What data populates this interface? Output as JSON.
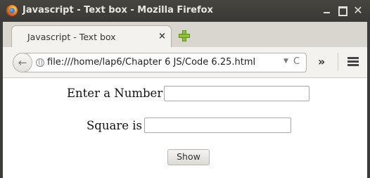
{
  "window": {
    "title": "Javascript - Text box - Mozilla Firefox",
    "close_glyph": "✕"
  },
  "tabs": [
    {
      "label": "Javascript - Text box",
      "close_glyph": "×"
    }
  ],
  "navbar": {
    "back_glyph": "←",
    "url": "file:///home/lap6/Chapter 6 JS/Code 6.25.html",
    "dropdown_glyph": "▼",
    "reload_glyph": "C",
    "overflow_glyph": "»"
  },
  "form": {
    "number_label": "Enter a Number",
    "number_value": "",
    "square_label": "Square is",
    "square_value": "",
    "show_button": "Show"
  },
  "icons": [
    "firefox-logo-icon",
    "minimize-icon",
    "maximize-icon",
    "close-icon",
    "new-tab-icon",
    "back-arrow-icon",
    "globe-icon",
    "reload-icon",
    "overflow-icon",
    "menu-icon"
  ]
}
